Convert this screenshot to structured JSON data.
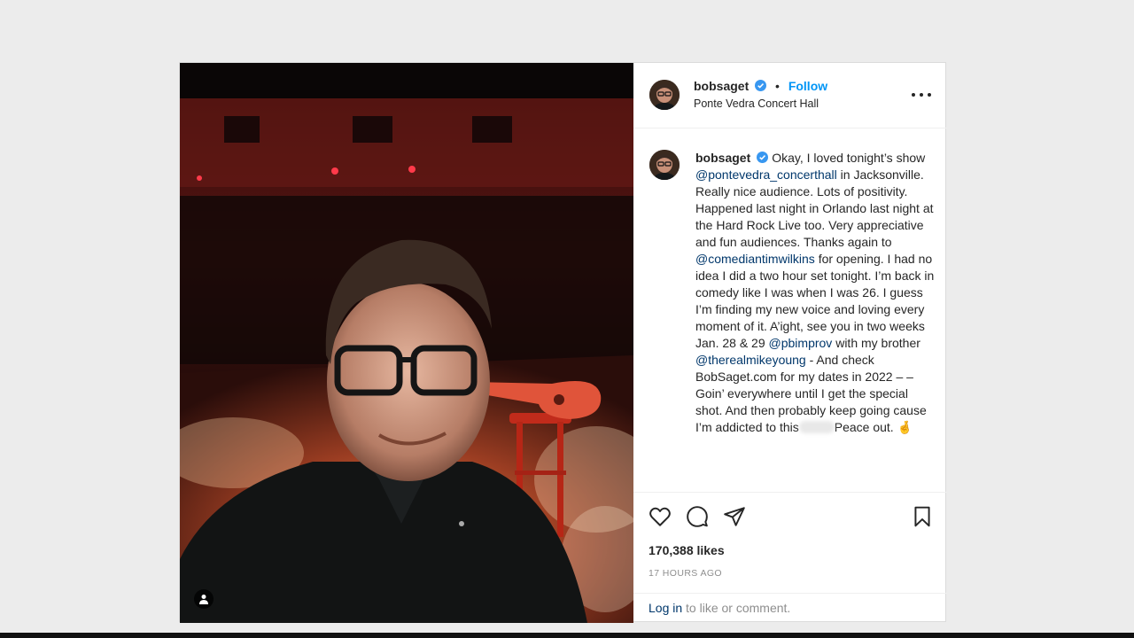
{
  "post": {
    "username": "bobsaget",
    "location": "Ponte Vedra Concert Hall",
    "follow_label": "Follow",
    "separator": "•",
    "caption": [
      {
        "t": "text",
        "v": "Okay, I loved tonight’s show "
      },
      {
        "t": "mention",
        "v": "@pontevedra_concerthall"
      },
      {
        "t": "text",
        "v": " in Jacksonville. Really nice audience. Lots of positivity. Happened last night in Orlando last night at the Hard Rock Live too. Very appreciative and fun audiences. Thanks again to "
      },
      {
        "t": "mention",
        "v": "@comediantimwilkins"
      },
      {
        "t": "text",
        "v": " for opening. I had no idea I did a two hour set tonight. I’m back in comedy like I was when I was 26. I guess I’m finding my new voice and loving every moment of it. A’ight, see you in two weeks Jan. 28 & 29 "
      },
      {
        "t": "mention",
        "v": "@pbimprov"
      },
      {
        "t": "text",
        "v": " with my brother "
      },
      {
        "t": "mention",
        "v": "@therealmikeyoung"
      },
      {
        "t": "text",
        "v": " - And check BobSaget.com for my dates in 2022 – – Goin’ everywhere until I get the special shot. And then probably keep going cause I’m addicted to this"
      },
      {
        "t": "blur",
        "v": ""
      },
      {
        "t": "text",
        "v": "Peace out. 🤞"
      }
    ],
    "likes": "170,388 likes",
    "time_ago": "17 HOURS AGO",
    "login_link": "Log in",
    "login_rest": " to like or comment."
  },
  "icons": {
    "verified": "verified-badge-icon",
    "more": "more-options-icon",
    "like": "heart-icon",
    "comment": "comment-icon",
    "share": "paper-plane-icon",
    "save": "bookmark-icon",
    "tag": "user-tag-icon"
  },
  "colors": {
    "accent": "#0095f6",
    "mention": "#00376b",
    "muted": "#8e8e8e"
  }
}
